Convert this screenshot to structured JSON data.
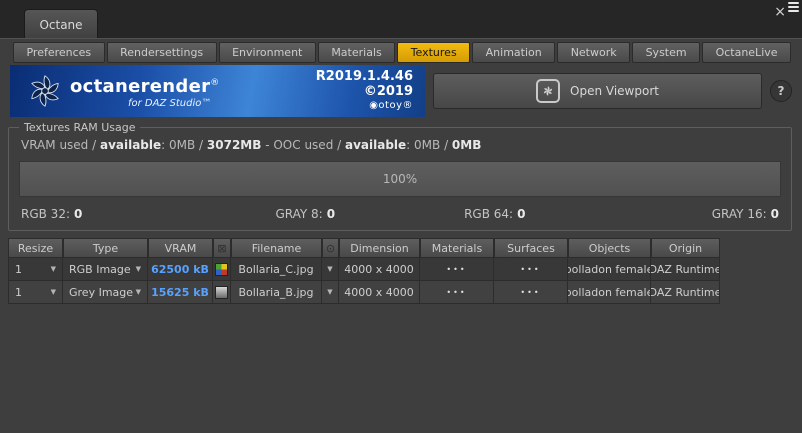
{
  "window": {
    "title": "Octane",
    "close_glyph": "×"
  },
  "tabs": [
    "Preferences",
    "Rendersettings",
    "Environment",
    "Materials",
    "Textures",
    "Animation",
    "Network",
    "System",
    "OctaneLive"
  ],
  "active_tab": "Textures",
  "banner": {
    "brand": "octanerender",
    "reg": "®",
    "sub": "for DAZ Studio™",
    "version": "R2019.1.4.46",
    "copyright": "©2019",
    "otoy_mark": "◉",
    "otoy": "otoy®"
  },
  "toolbar": {
    "open_viewport_label": "Open Viewport",
    "help_label": "?"
  },
  "ram": {
    "group_label": "Textures RAM Usage",
    "segments": [
      {
        "text": "VRAM used / "
      },
      {
        "text": "available"
      },
      {
        "text": ": 0MB / "
      },
      {
        "text": "3072MB"
      },
      {
        "text": " - OOC used / "
      },
      {
        "text": "available"
      },
      {
        "text": ": 0MB / "
      },
      {
        "text": "0MB"
      }
    ],
    "progress_percent": 100,
    "progress_label": "100%",
    "stats": [
      {
        "label": "RGB 32:",
        "value": "0"
      },
      {
        "label": "GRAY 8:",
        "value": "0"
      },
      {
        "label": "RGB 64:",
        "value": "0"
      },
      {
        "label": "GRAY 16:",
        "value": "0"
      }
    ]
  },
  "table": {
    "headers": {
      "resize": "Resize",
      "type": "Type",
      "vram": "VRAM",
      "filename": "Filename",
      "dimension": "Dimension",
      "materials": "Materials",
      "surfaces": "Surfaces",
      "objects": "Objects",
      "origin": "Origin"
    },
    "rows": [
      {
        "resize": "1",
        "type": "RGB Image",
        "vram": "62500 kB",
        "thumb": "rgb",
        "filename": "Bollaria_C.jpg",
        "dimension": "4000 x 4000",
        "materials": "•••",
        "surfaces": "•••",
        "objects": "bolladon female",
        "origin": "DAZ Runtime"
      },
      {
        "resize": "1",
        "type": "Grey Image",
        "vram": "15625 kB",
        "thumb": "grey",
        "filename": "Bollaria_B.jpg",
        "dimension": "4000 x 4000",
        "materials": "•••",
        "surfaces": "•••",
        "objects": "bolladon female",
        "origin": "DAZ Runtime"
      }
    ]
  },
  "icons": {
    "dropdown": "▼",
    "box_x": "⊠",
    "circle_dot": "⊙"
  },
  "colors": {
    "active_tab": "#e9b306",
    "vram_text": "#58a2ff",
    "banner_blue": "#1d54ab"
  }
}
